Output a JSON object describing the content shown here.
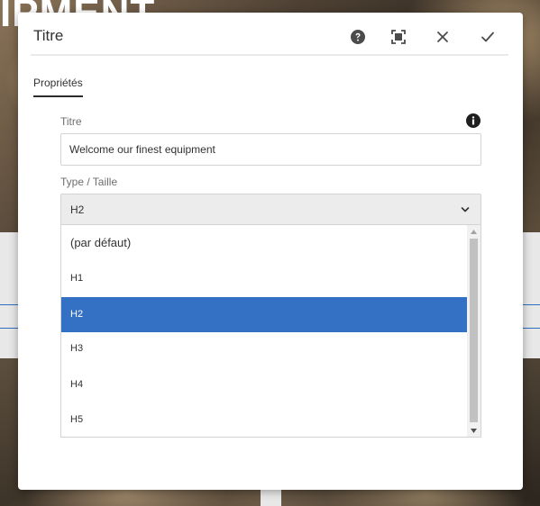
{
  "background": {
    "hero_text": "IPMENT"
  },
  "dialog": {
    "title": "Titre",
    "actions": {
      "help_icon": "help-circle-icon",
      "fullscreen_icon": "fullscreen-icon",
      "close_icon": "close-icon",
      "done_icon": "checkmark-icon"
    },
    "tabs": [
      {
        "label": "Propriétés",
        "active": true
      }
    ],
    "fields": {
      "titre": {
        "label": "Titre",
        "value": "Welcome our finest equipment",
        "info_icon": "info-icon"
      },
      "type": {
        "label": "Type / Taille",
        "selected": "H2",
        "options": [
          {
            "label": "(par défaut)"
          },
          {
            "label": "H1"
          },
          {
            "label": "H2"
          },
          {
            "label": "H3"
          },
          {
            "label": "H4"
          },
          {
            "label": "H5"
          }
        ],
        "highlighted_index": 2
      }
    }
  },
  "colors": {
    "selection": "#3470c4",
    "dialog_bg": "#ffffff",
    "select_bg": "#ececec"
  }
}
